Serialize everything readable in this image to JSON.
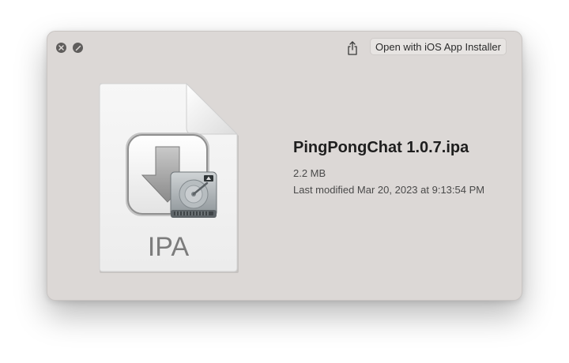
{
  "window": {
    "open_with_label": "Open with iOS App Installer",
    "close_icon": "close-icon",
    "fullscreen_icon": "fullscreen-icon",
    "share_icon": "share-icon"
  },
  "file": {
    "name": "PingPongChat 1.0.7.ipa",
    "size": "2.2 MB",
    "modified": "Last modified Mar 20, 2023 at 9:13:54 PM",
    "icon_label": "IPA",
    "icon": "ipa-file-icon"
  },
  "colors": {
    "window_bg": "#dcd8d6",
    "traffic_light": "#5f5d5c",
    "text_primary": "#1e1e1e",
    "text_secondary": "#4a4a4a"
  }
}
